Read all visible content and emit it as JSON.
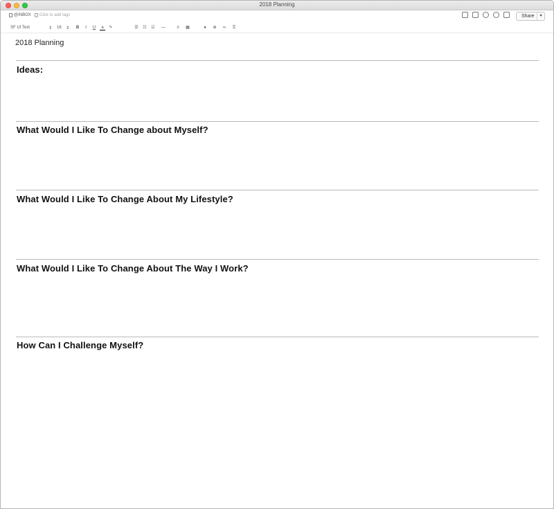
{
  "window": {
    "title": "2018 Planning"
  },
  "meta": {
    "notebook": "@INBOX",
    "tags_placeholder": "Click to add tags",
    "share_label": "Share"
  },
  "format_bar": {
    "font": "SF UI Text",
    "size": "16",
    "bold": "B",
    "italic": "I",
    "underline": "U",
    "color": "a",
    "highlight": "✎",
    "divider": "—"
  },
  "note": {
    "title": "2018 Planning",
    "headings": [
      "Ideas:",
      "What Would I Like To Change about Myself?",
      "What Would I Like To Change About My Lifestyle?",
      "What Would I Like To Change About The Way I Work?",
      "How Can I Challenge Myself?"
    ]
  },
  "icons": {
    "toolbar_right": [
      "alarm-icon",
      "present-icon",
      "shortcut-icon",
      "info-icon",
      "trash-icon"
    ],
    "format": [
      "bullet-list-icon",
      "numbered-list-icon",
      "checklist-icon",
      "align-icon",
      "table-icon",
      "mic-icon",
      "attach-icon",
      "link-icon",
      "encrypt-icon"
    ]
  }
}
